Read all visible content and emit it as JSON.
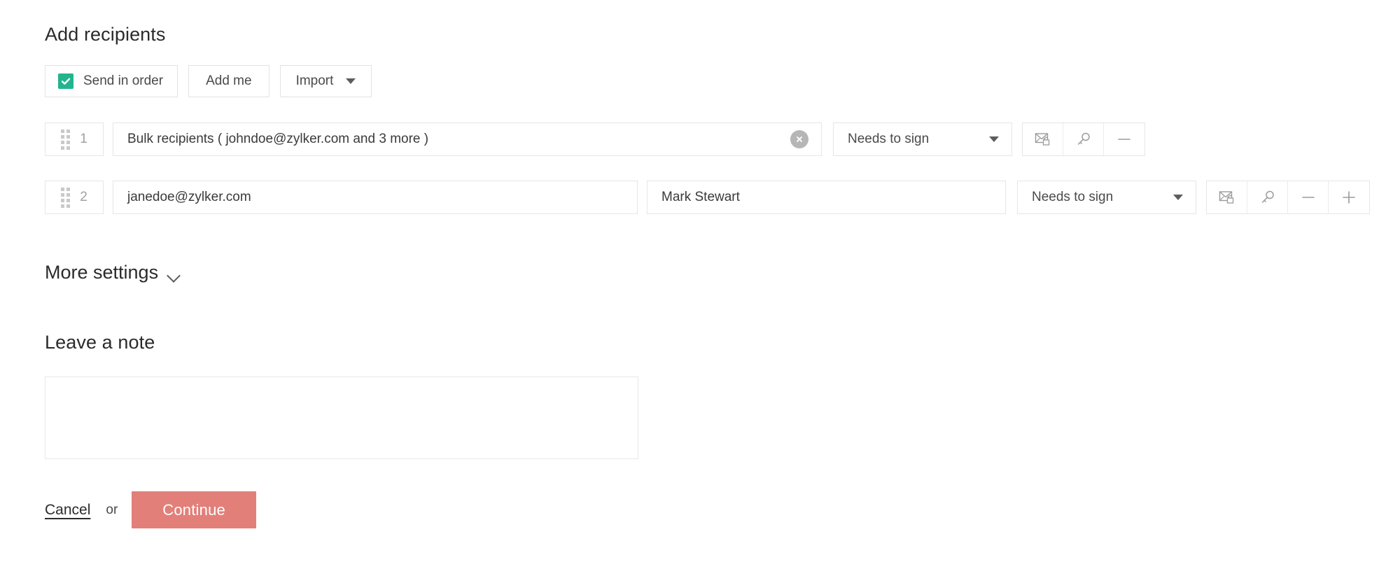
{
  "colors": {
    "checkbox_green": "#21b48f",
    "continue_button": "#e27f79",
    "clear_button_gray": "#b6b6b6",
    "border_gray": "#e6e6e6",
    "text_primary": "#2b2b2b",
    "text_muted": "#a0a0a0"
  },
  "recipients_section": {
    "title": "Add recipients",
    "toolbar": {
      "send_in_order_label": "Send in order",
      "send_in_order_checked": true,
      "add_me_label": "Add me",
      "import_label": "Import"
    },
    "rows": [
      {
        "number": "1",
        "email": "Bulk recipients ( johndoe@zylker.com and 3 more )",
        "name": "",
        "has_name_field": false,
        "has_clear_button": true,
        "role": "Needs to sign",
        "actions": [
          "private-message-icon",
          "access-code-icon",
          "remove-row-icon"
        ]
      },
      {
        "number": "2",
        "email": "janedoe@zylker.com",
        "name": "Mark Stewart",
        "has_name_field": true,
        "has_clear_button": false,
        "role": "Needs to sign",
        "actions": [
          "private-message-icon",
          "access-code-icon",
          "remove-row-icon",
          "add-row-icon"
        ]
      }
    ]
  },
  "more_settings": {
    "label": "More settings",
    "expanded": false,
    "chevron": "chevron-down-icon"
  },
  "note_section": {
    "title": "Leave a note",
    "value": "",
    "placeholder": ""
  },
  "footer": {
    "cancel_label": "Cancel",
    "or_label": "or",
    "continue_label": "Continue"
  }
}
